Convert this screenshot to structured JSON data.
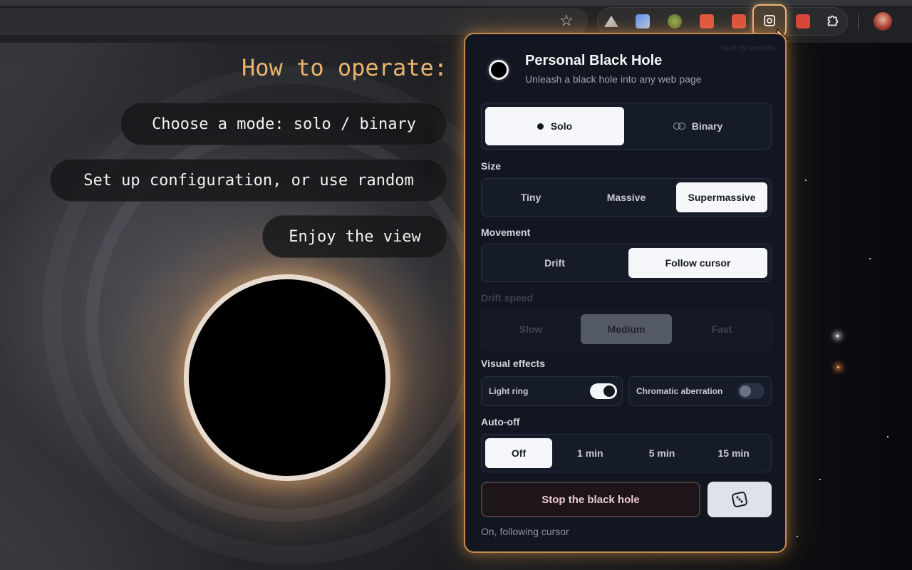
{
  "browser": {
    "bookmark_icon": "star-icon",
    "extensions_icon": "puzzle-icon",
    "active_extension": "personal-black-hole"
  },
  "page": {
    "heading": "How to operate:",
    "steps": [
      "Choose a mode: solo / binary",
      "Set up configuration, or use random",
      "Enjoy the view"
    ]
  },
  "popup": {
    "made_by": "made by severmx",
    "title": "Personal Black Hole",
    "subtitle": "Unleash a black hole into any web page",
    "mode": {
      "options": [
        "Solo",
        "Binary"
      ],
      "selected": "Solo"
    },
    "size": {
      "label": "Size",
      "options": [
        "Tiny",
        "Massive",
        "Supermassive"
      ],
      "selected": "Supermassive"
    },
    "movement": {
      "label": "Movement",
      "options": [
        "Drift",
        "Follow cursor"
      ],
      "selected": "Follow cursor"
    },
    "drift_speed": {
      "label": "Drift speed",
      "options": [
        "Slow",
        "Medium",
        "Fast"
      ],
      "selected": "Medium",
      "disabled": true
    },
    "visual_effects": {
      "label": "Visual effects",
      "light_ring": {
        "label": "Light ring",
        "on": true
      },
      "chromatic_aberration": {
        "label": "Chromatic aberration",
        "on": false
      }
    },
    "auto_off": {
      "label": "Auto-off",
      "options": [
        "Off",
        "1 min",
        "5 min",
        "15 min"
      ],
      "selected": "Off"
    },
    "stop_label": "Stop the black hole",
    "random_icon": "dice-icon",
    "status": "On, following cursor",
    "accent": "#c48a4e"
  }
}
